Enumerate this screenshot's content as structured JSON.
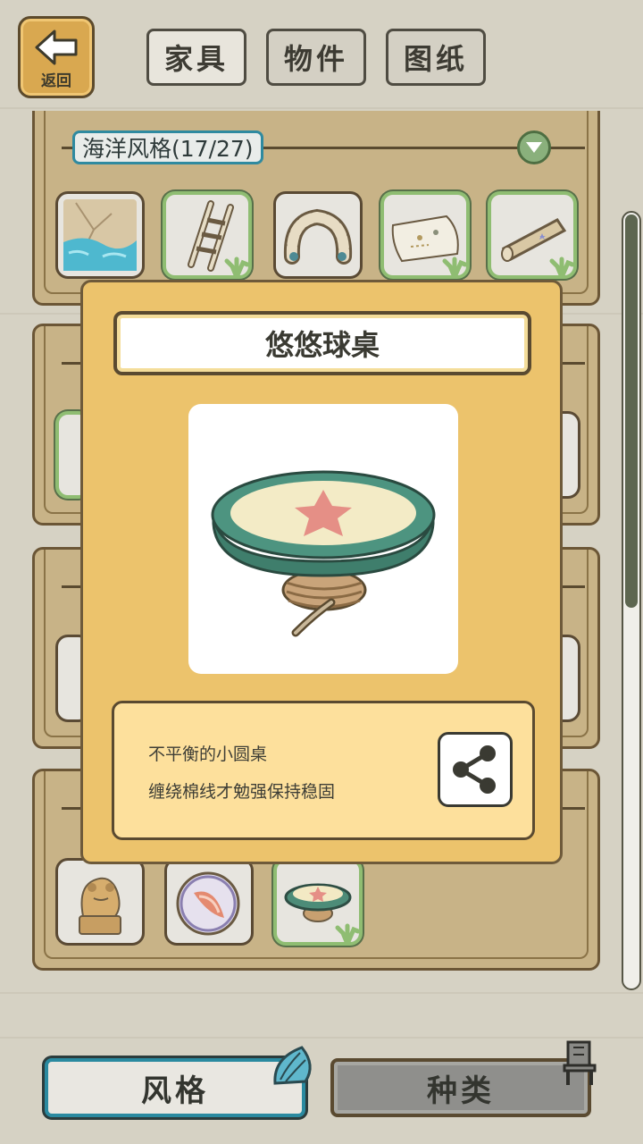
{
  "nav": {
    "back_label": "返回",
    "tabs": [
      {
        "label": "家具",
        "active": true
      },
      {
        "label": "物件",
        "active": false
      },
      {
        "label": "图纸",
        "active": false
      }
    ]
  },
  "category": {
    "title": "海洋风格(17/27)",
    "items": [
      {
        "icon": "pool-icon",
        "owned": false
      },
      {
        "icon": "ladder-icon",
        "owned": true
      },
      {
        "icon": "stone-arch-icon",
        "owned": false
      },
      {
        "icon": "treasure-map-icon",
        "owned": true
      },
      {
        "icon": "rolled-mat-icon",
        "owned": true
      }
    ]
  },
  "bottom_row": {
    "items": [
      {
        "icon": "stone-frog-statue-icon",
        "owned": false
      },
      {
        "icon": "shell-orb-icon",
        "owned": false
      },
      {
        "icon": "starfish-table-icon",
        "owned": true
      }
    ]
  },
  "modal": {
    "item_name": "悠悠球桌",
    "item_icon": "starfish-table-icon",
    "description_line1": "不平衡的小圆桌",
    "description_line2": "缠绕棉线才勉强保持稳固",
    "share_icon": "share-icon"
  },
  "bottom_nav": {
    "style_label": "风格",
    "kind_label": "种类",
    "style_icon": "seashell-icon",
    "kind_icon": "chair-icon"
  },
  "colors": {
    "modal_bg": "#ecc36c",
    "panel_bg": "#c8b387",
    "accent_teal": "#2f8aa0",
    "owned_green": "#8fbd72"
  }
}
